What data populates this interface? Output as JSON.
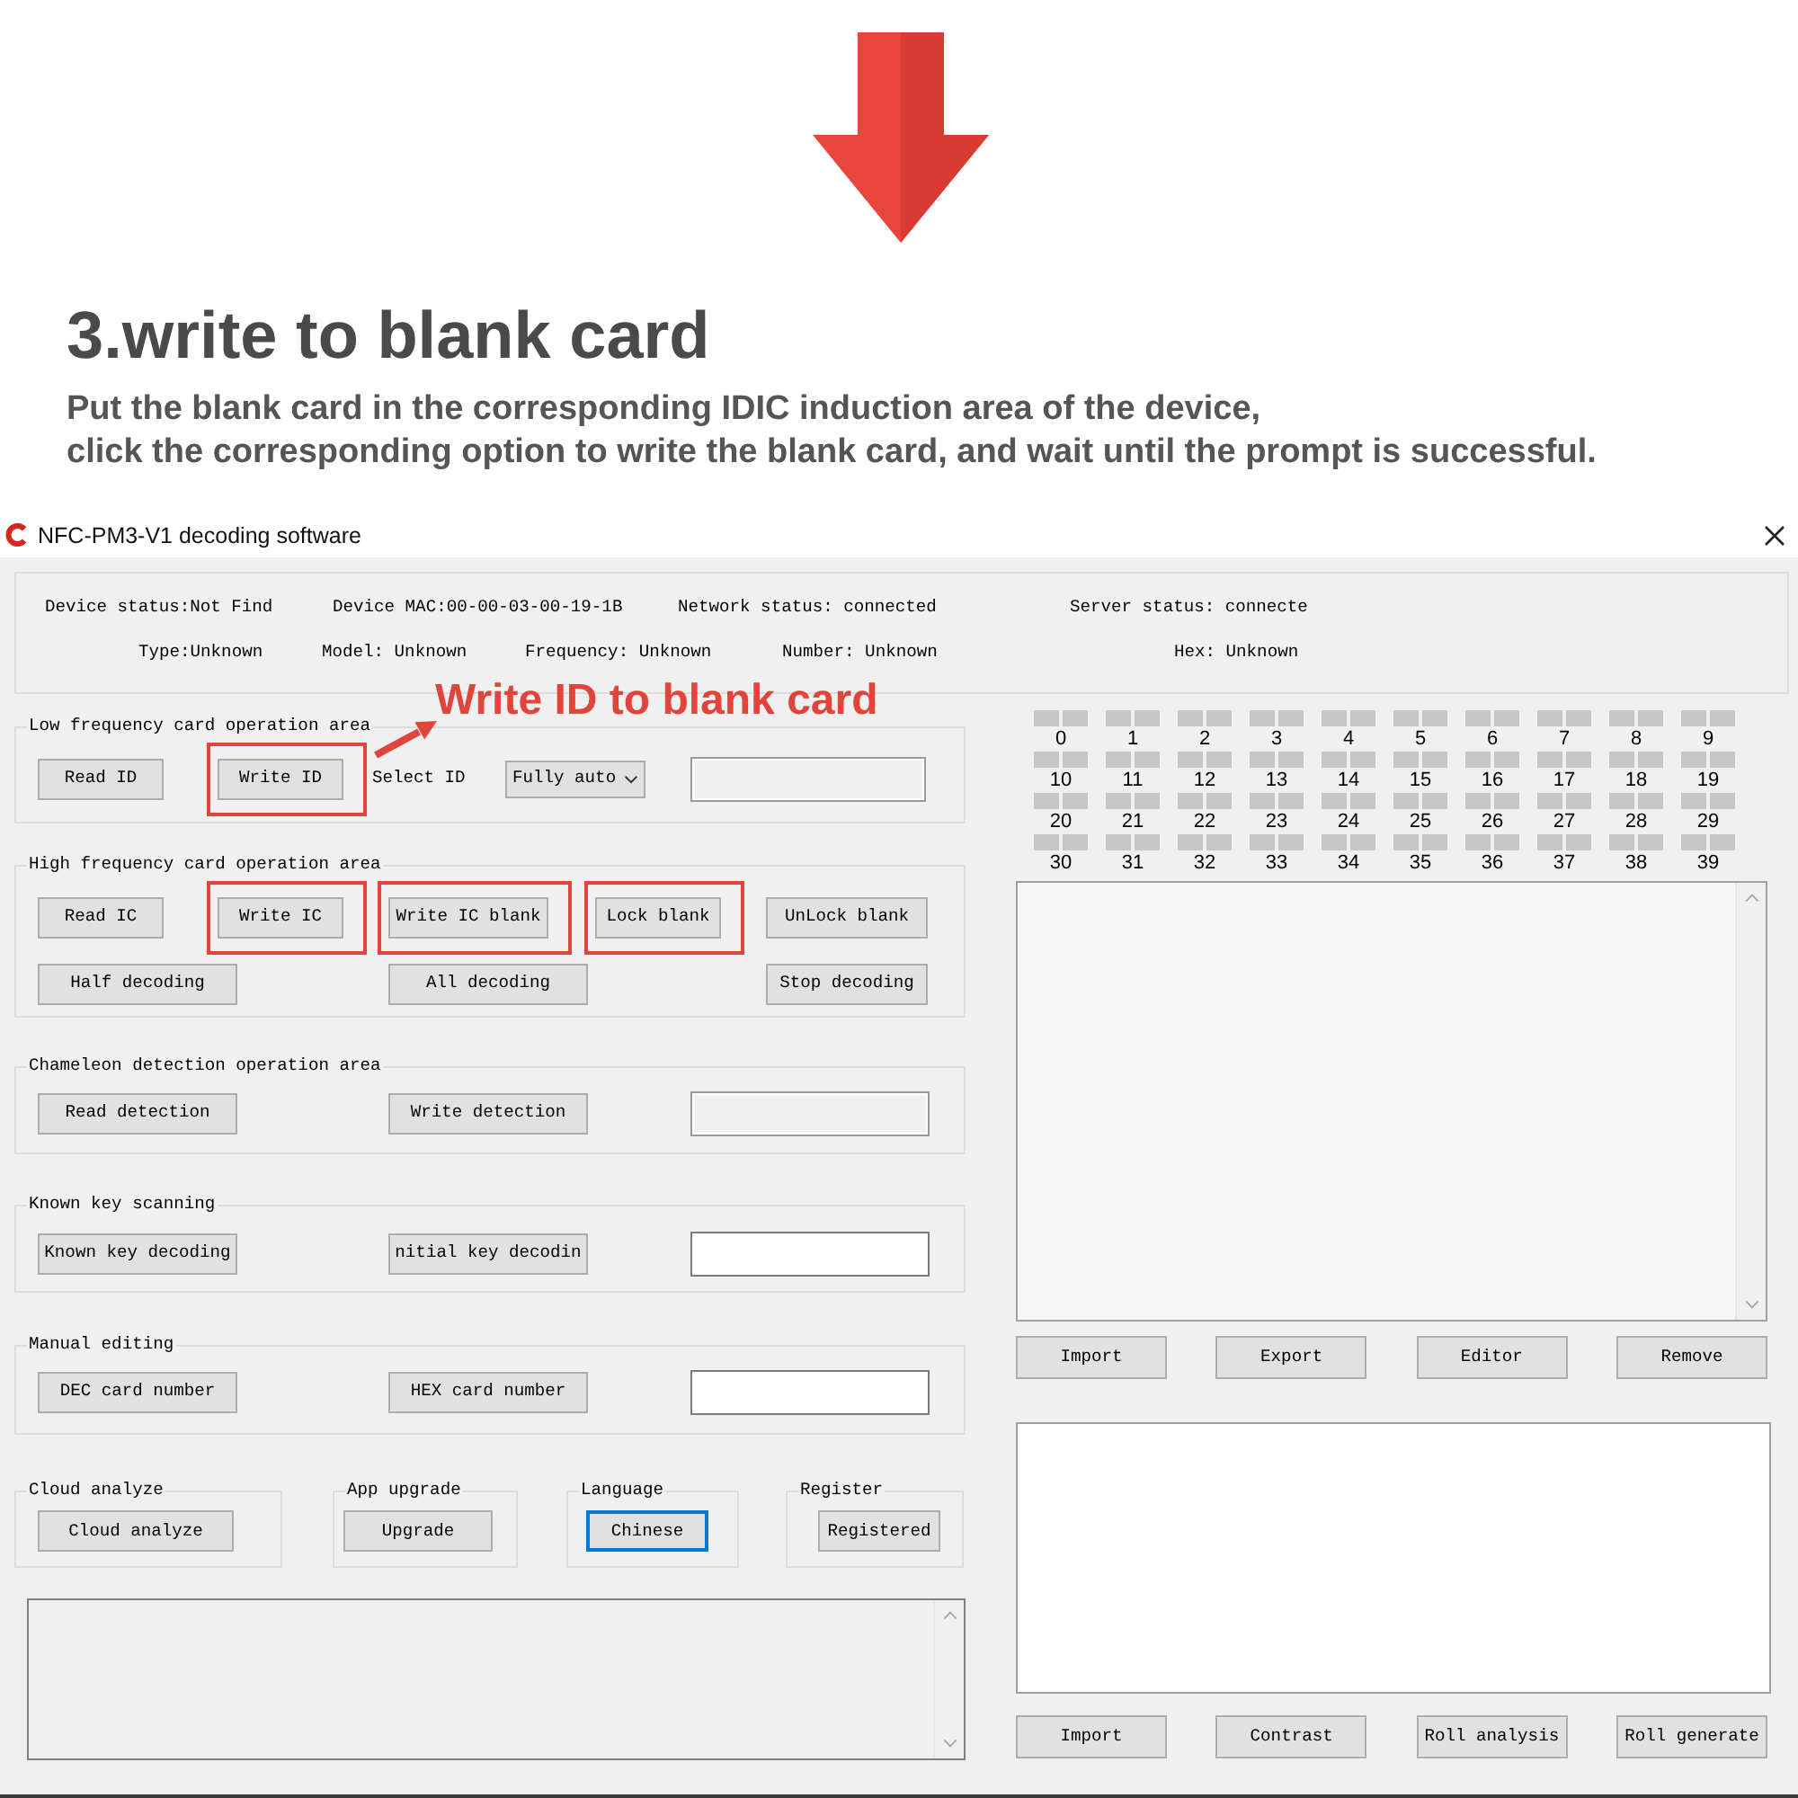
{
  "banner": {
    "heading": "3.write to blank card",
    "lines": [
      "Put the blank card in the corresponding IDIC induction area of the device,",
      "click the corresponding option to write the blank card, and wait until the prompt is successful."
    ]
  },
  "window": {
    "title": "NFC-PM3-V1 decoding software"
  },
  "status_rows": [
    [
      "Device status:Not Find",
      "Device MAC:00-00-03-00-19-1B",
      "Network status: connected",
      "Server status: connecte"
    ],
    [
      "Type:Unknown",
      "Model: Unknown",
      "Frequency: Unknown",
      "Number: Unknown",
      "Hex: Unknown"
    ]
  ],
  "annotation": "Write ID to blank card",
  "groups": [
    {
      "title": "Low frequency card operation area",
      "rows": [
        [
          {
            "kind": "button",
            "label": "Read ID",
            "highlighted": false
          },
          {
            "kind": "button",
            "label": "Write ID",
            "highlighted": true
          },
          {
            "kind": "label",
            "text": "Select ID"
          },
          {
            "kind": "dropdown",
            "value": "Fully auto"
          },
          {
            "kind": "field",
            "disabled": true
          }
        ]
      ]
    },
    {
      "title": "High frequency card operation area",
      "rows": [
        [
          {
            "kind": "button",
            "label": "Read IC",
            "highlighted": false
          },
          {
            "kind": "button",
            "label": "Write IC",
            "highlighted": true
          },
          {
            "kind": "button",
            "label": "Write IC blank",
            "highlighted": true
          },
          {
            "kind": "button",
            "label": "Lock blank",
            "highlighted": true
          },
          {
            "kind": "button",
            "label": "UnLock blank",
            "highlighted": false
          }
        ],
        [
          {
            "kind": "button",
            "label": "Half decoding",
            "highlighted": false
          },
          "",
          {
            "kind": "button",
            "label": "All decoding",
            "highlighted": false
          },
          "",
          {
            "kind": "button",
            "label": "Stop decoding",
            "highlighted": false
          }
        ]
      ]
    },
    {
      "title": "Chameleon detection operation area",
      "rows": [
        [
          {
            "kind": "button",
            "label": "Read detection",
            "highlighted": false
          },
          {
            "kind": "button",
            "label": "Write detection",
            "highlighted": false
          },
          {
            "kind": "field",
            "disabled": true
          }
        ]
      ]
    },
    {
      "title": "Known key scanning",
      "rows": [
        [
          {
            "kind": "button",
            "label": "Known key decoding",
            "highlighted": false
          },
          {
            "kind": "button",
            "label": "nitial key decodin",
            "highlighted": false
          },
          {
            "kind": "field",
            "disabled": false
          }
        ]
      ]
    },
    {
      "title": "Manual editing",
      "rows": [
        [
          {
            "kind": "button",
            "label": "DEC card number",
            "highlighted": false
          },
          {
            "kind": "button",
            "label": "HEX card number",
            "highlighted": false
          },
          {
            "kind": "field",
            "disabled": false
          }
        ]
      ]
    }
  ],
  "small_groups": [
    {
      "title": "Cloud analyze",
      "button": "Cloud analyze",
      "focused": false
    },
    {
      "title": "App upgrade",
      "button": "Upgrade",
      "focused": false
    },
    {
      "title": "Language",
      "button": "Chinese",
      "focused": true
    },
    {
      "title": "Register",
      "button": "Registered",
      "focused": false
    }
  ],
  "sector_indicators": [
    "0",
    "1",
    "2",
    "3",
    "4",
    "5",
    "6",
    "7",
    "8",
    "9",
    "10",
    "11",
    "12",
    "13",
    "14",
    "15",
    "16",
    "17",
    "18",
    "19",
    "20",
    "21",
    "22",
    "23",
    "24",
    "25",
    "26",
    "27",
    "28",
    "29",
    "30",
    "31",
    "32",
    "33",
    "34",
    "35",
    "36",
    "37",
    "38",
    "39"
  ],
  "key_list_buttons": [
    "Import",
    "Export",
    "Editor",
    "Remove"
  ],
  "result_buttons": [
    "Import",
    "Contrast",
    "Roll analysis",
    "Roll generate"
  ]
}
